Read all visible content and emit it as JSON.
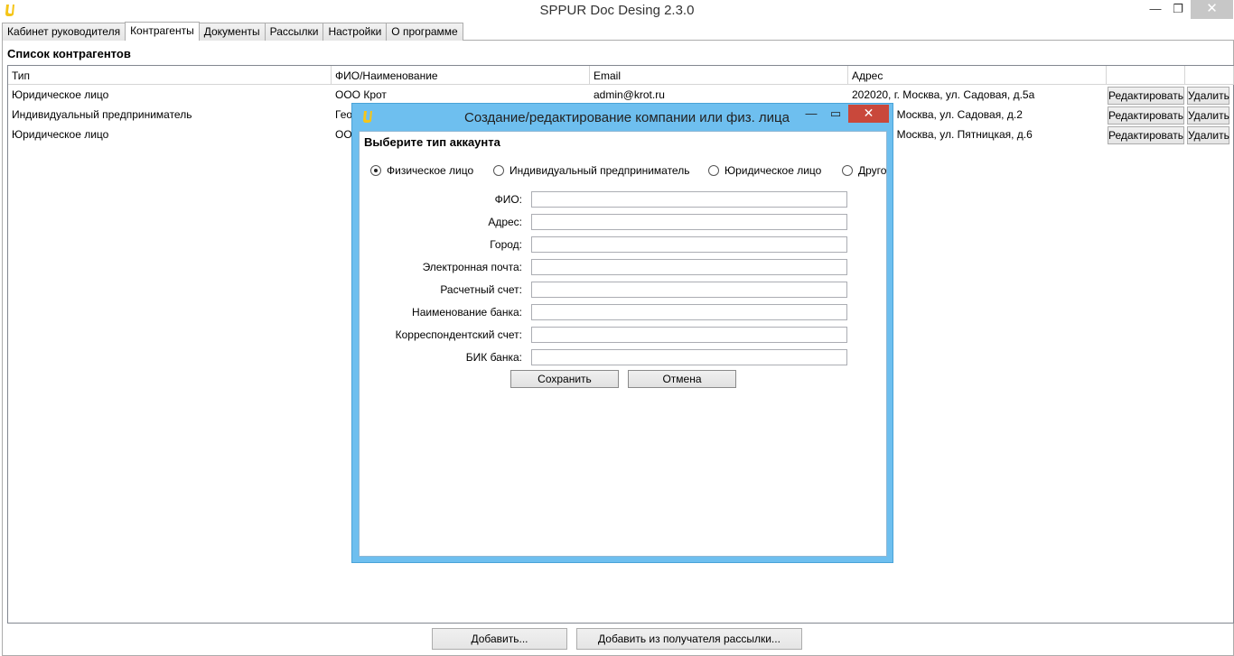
{
  "window": {
    "title": "SPPUR Doc Desing 2.3.0",
    "min_glyph": "—",
    "max_glyph": "❐",
    "close_glyph": "✕"
  },
  "tabs": [
    {
      "label": "Кабинет руководителя",
      "active": false
    },
    {
      "label": "Контрагенты",
      "active": true
    },
    {
      "label": "Документы",
      "active": false
    },
    {
      "label": "Рассылки",
      "active": false
    },
    {
      "label": "Настройки",
      "active": false
    },
    {
      "label": "О программе",
      "active": false
    }
  ],
  "contractors": {
    "title": "Список контрагентов",
    "columns": [
      "Тип",
      "ФИО/Наименование",
      "Email",
      "Адрес"
    ],
    "rows": [
      {
        "type": "Юридическое лицо",
        "name": "ООО Крот",
        "email": "admin@krot.ru",
        "address": "202020, г. Москва, ул. Садовая, д.5а"
      },
      {
        "type": "Индивидуальный предприниматель",
        "name": "Гео",
        "email": "",
        "address": "г. Москва, ул. Садовая, д.2"
      },
      {
        "type": "Юридическое лицо",
        "name": "ОО",
        "email": "",
        "address": "г. Москва, ул. Пятницкая, д.6"
      }
    ],
    "edit_label": "Редактировать",
    "delete_label": "Удалить"
  },
  "bottom": {
    "add_label": "Добавить...",
    "add_from_label": "Добавить из получателя рассылки..."
  },
  "dialog": {
    "title": "Создание/редактирование компании или физ. лица",
    "min_glyph": "—",
    "max_glyph": "▭",
    "close_glyph": "✕",
    "heading": "Выберите тип аккаунта",
    "account_types": [
      {
        "label": "Физическое лицо",
        "selected": true
      },
      {
        "label": "Индивидуальный предприниматель",
        "selected": false
      },
      {
        "label": "Юридическое лицо",
        "selected": false
      },
      {
        "label": "Друго",
        "selected": false
      }
    ],
    "fields": [
      {
        "label": "ФИО:",
        "value": ""
      },
      {
        "label": "Адрес:",
        "value": ""
      },
      {
        "label": "Город:",
        "value": ""
      },
      {
        "label": "Электронная почта:",
        "value": ""
      },
      {
        "label": "Расчетный счет:",
        "value": ""
      },
      {
        "label": "Наименование банка:",
        "value": ""
      },
      {
        "label": "Корреспондентский счет:",
        "value": ""
      },
      {
        "label": "БИК банка:",
        "value": ""
      }
    ],
    "save_label": "Сохранить",
    "cancel_label": "Отмена"
  },
  "colors": {
    "dialog_frame": "#6ebfef",
    "dialog_close": "#c9483b",
    "app_icon": "#f5c518"
  }
}
